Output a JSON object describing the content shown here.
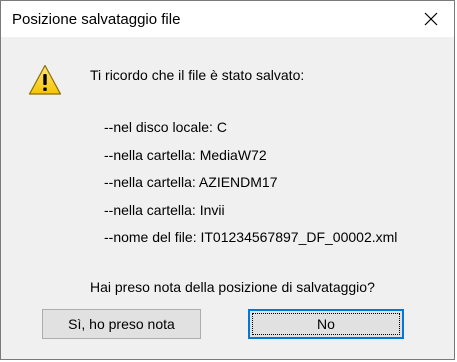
{
  "window": {
    "title": "Posizione salvataggio file",
    "close_glyph": "✕"
  },
  "message": {
    "intro": "Ti ricordo che il file è stato salvato:",
    "lines": [
      "--nel disco locale: C",
      "--nella cartella: MediaW72",
      "--nella cartella: AZIENDM17",
      "--nella cartella: Invii",
      "--nome del file: IT01234567897_DF_00002.xml"
    ],
    "question": "Hai preso nota della posizione di salvataggio?"
  },
  "buttons": {
    "yes_label": "Sì, ho preso nota",
    "no_label": "No"
  },
  "icons": {
    "warning": "warning-icon",
    "close": "close-icon"
  },
  "colors": {
    "titlebar": "#ffffff",
    "client": "#f0f0f0",
    "focus_border": "#0078d7",
    "warning_fill": "#ffd700"
  }
}
